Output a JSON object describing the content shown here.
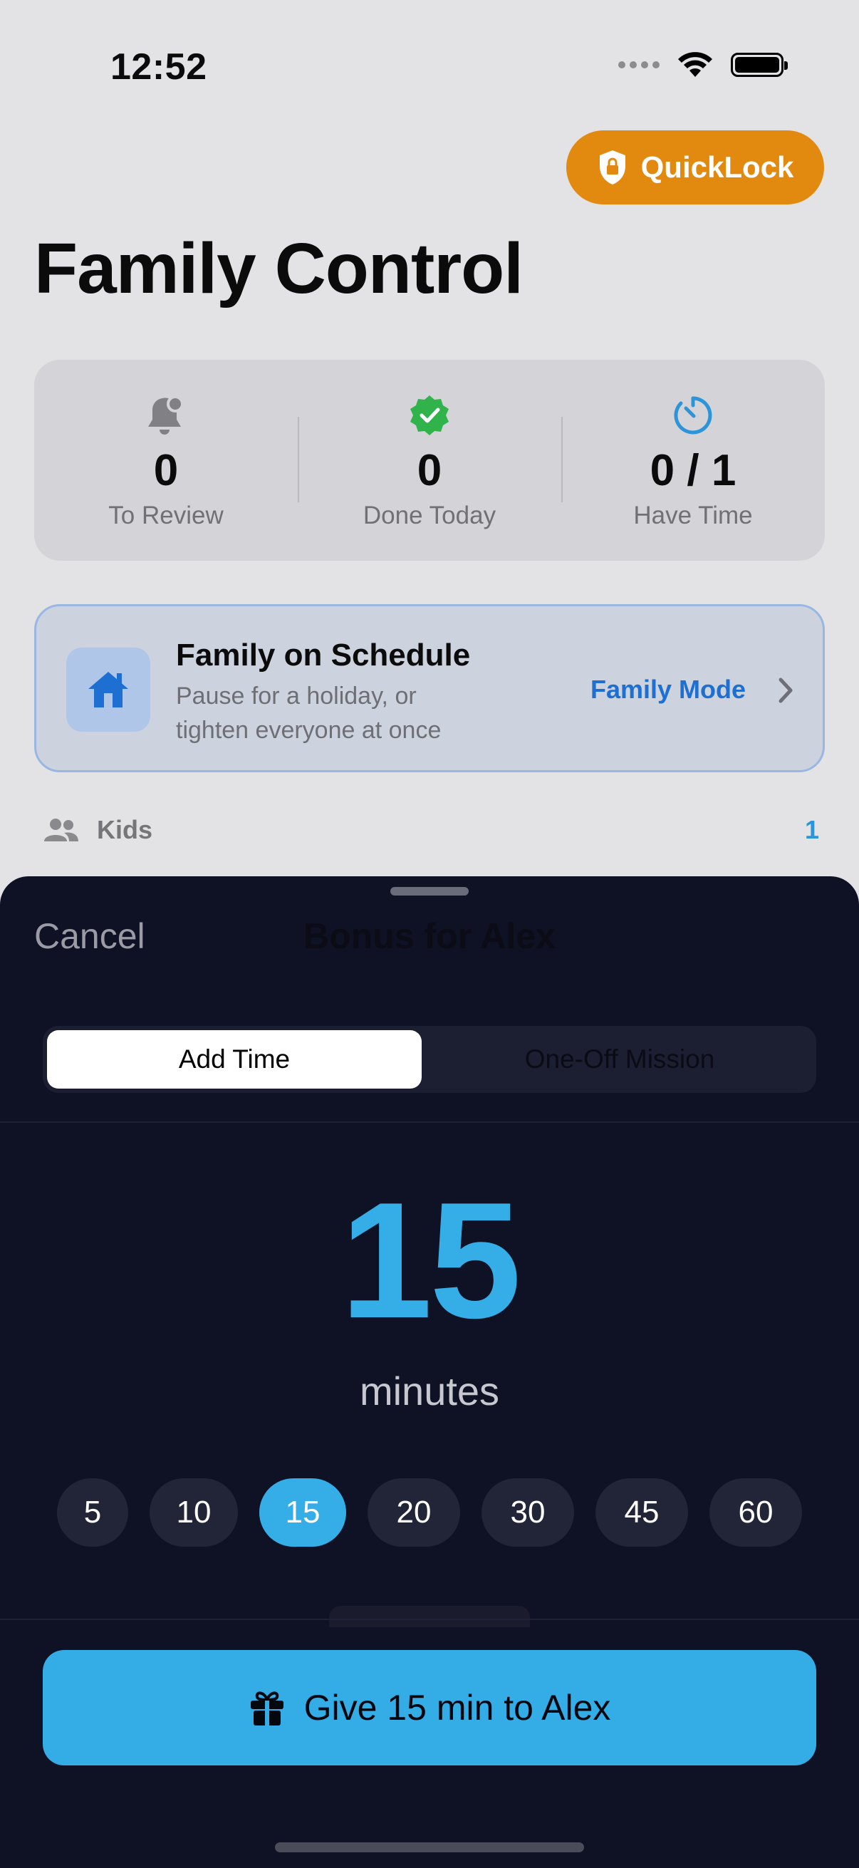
{
  "status_bar": {
    "time": "12:52"
  },
  "header": {
    "quicklock_label": "QuickLock",
    "title": "Family Control"
  },
  "stats": [
    {
      "icon": "bell-icon",
      "value": "0",
      "label": "To Review"
    },
    {
      "icon": "checkmark-seal-icon",
      "value": "0",
      "label": "Done Today"
    },
    {
      "icon": "timer-icon",
      "value": "0 / 1",
      "label": "Have Time"
    }
  ],
  "family_card": {
    "title": "Family on Schedule",
    "subtitle": "Pause for a holiday, or tighten everyone at once",
    "action": "Family Mode"
  },
  "kids_section": {
    "label": "Kids",
    "count": "1"
  },
  "sheet": {
    "cancel": "Cancel",
    "title": "Bonus for Alex",
    "segments": [
      "Add Time",
      "One-Off Mission"
    ],
    "selected_segment": "Add Time",
    "amount": "15",
    "unit": "minutes",
    "chips": [
      "5",
      "10",
      "15",
      "20",
      "30",
      "45",
      "60"
    ],
    "selected_chip": "15",
    "cta": "Give 15 min to Alex"
  },
  "colors": {
    "accent_blue": "#35ade6",
    "quicklock_orange": "#e28a10",
    "sheet_background": "#0f1124",
    "success_green": "#2fb34a",
    "link_blue": "#1d6fd1"
  }
}
